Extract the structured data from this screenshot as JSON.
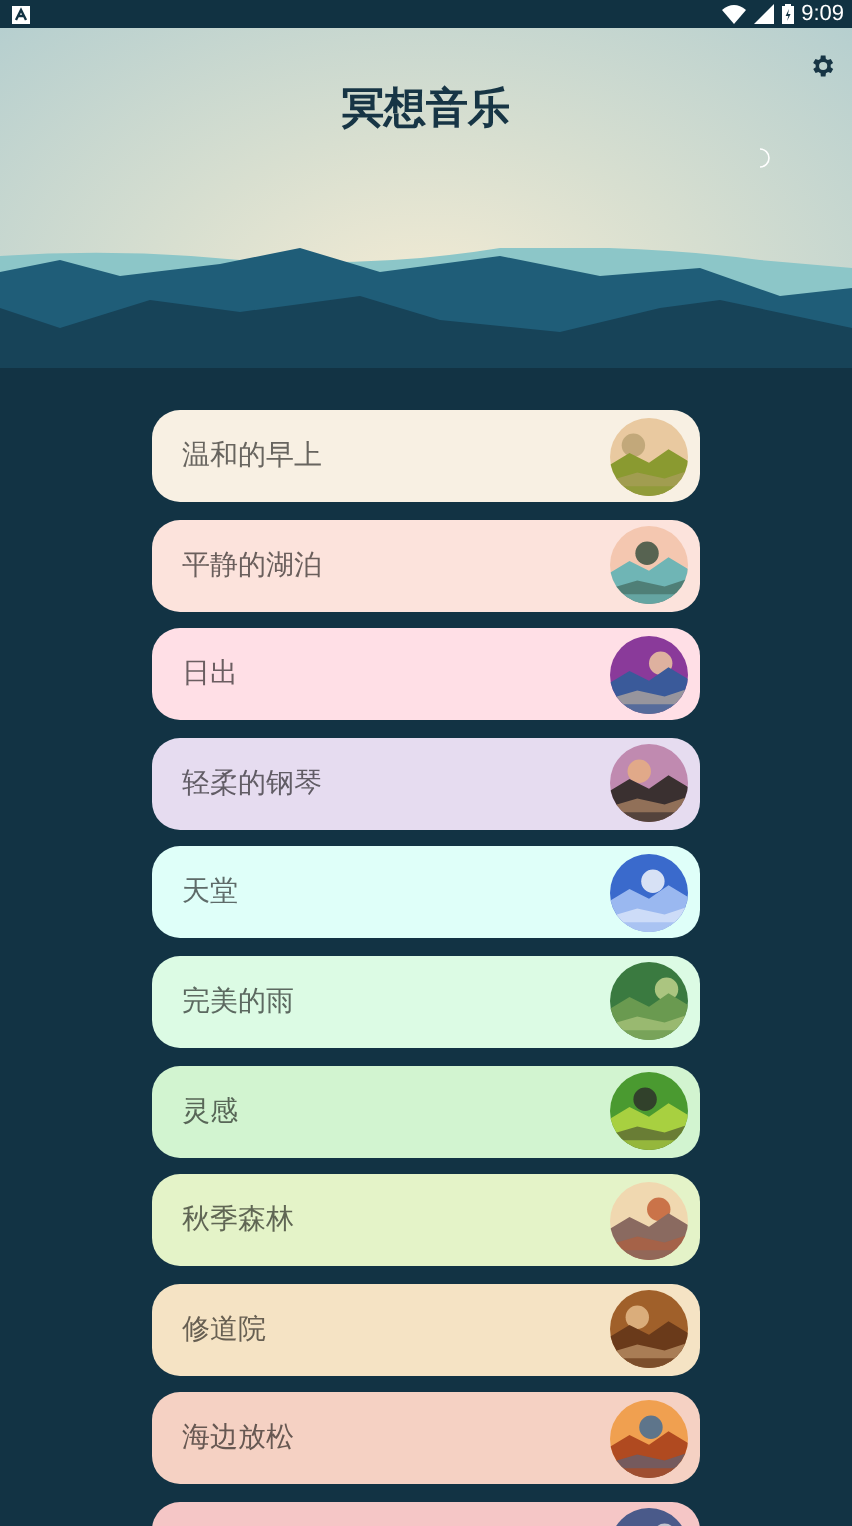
{
  "status_bar": {
    "time": "9:09"
  },
  "header": {
    "title": "冥想音乐"
  },
  "tracks": [
    {
      "title": "温和的早上",
      "color": "#f8f0e3"
    },
    {
      "title": "平静的湖泊",
      "color": "#fce3dc"
    },
    {
      "title": "日出",
      "color": "#ffdfe6"
    },
    {
      "title": "轻柔的钢琴",
      "color": "#e6dcf0"
    },
    {
      "title": "天堂",
      "color": "#dffff9"
    },
    {
      "title": "完美的雨",
      "color": "#dcfbe4"
    },
    {
      "title": "灵感",
      "color": "#d2f4d0"
    },
    {
      "title": "秋季森林",
      "color": "#e4f3c8"
    },
    {
      "title": "修道院",
      "color": "#f5e3c4"
    },
    {
      "title": "海边放松",
      "color": "#f5d1c3"
    },
    {
      "color": "#f5c6c6"
    }
  ]
}
